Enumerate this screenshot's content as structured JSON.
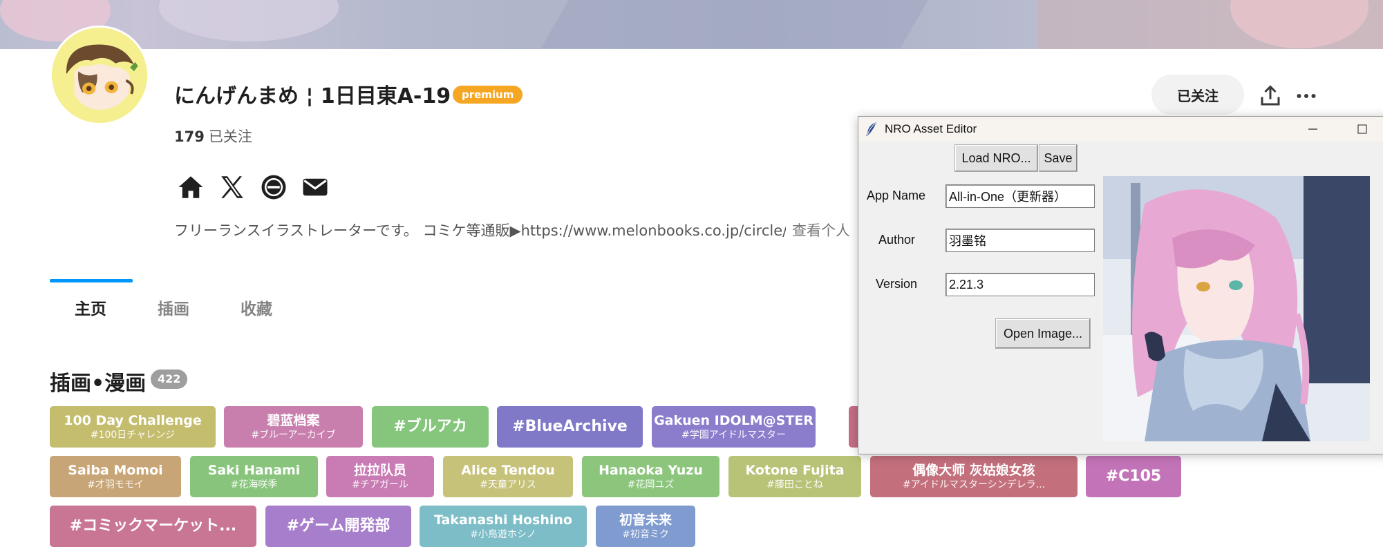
{
  "profile": {
    "name": "にんげんまめ ¦ 1日目東A-19",
    "premium": "premium",
    "follow_count": "179",
    "follow_label": "已关注",
    "bio": "フリーランスイラストレーターです。 コミケ等通販▶https://www.melonbooks.co.jp/circle/i",
    "bio_more": "查看个人",
    "follow_button": "已关注"
  },
  "tabs": [
    "主页",
    "插画",
    "收藏"
  ],
  "section": {
    "title": "插画•漫画",
    "count": "422"
  },
  "tags": [
    {
      "name": "100 Day Challenge",
      "sub": "#100日チャレンジ",
      "color": "#c4bd6e"
    },
    {
      "name": "碧蓝档案",
      "sub": "#ブルーアーカイブ",
      "color": "#c97fae"
    },
    {
      "name": "#ブルアカ",
      "sub": "",
      "color": "#85c57c"
    },
    {
      "name": "#BlueArchive",
      "sub": "",
      "color": "#7f79c8"
    },
    {
      "name": "Gakuen IDOLM@STER",
      "sub": "#学園アイドルマスター",
      "color": "#8b7dcc"
    },
    {
      "name": "",
      "sub": "",
      "color": "#c56f86"
    },
    {
      "name": "Saiba Momoi",
      "sub": "#才羽モモイ",
      "color": "#c8a577"
    },
    {
      "name": "Saki Hanami",
      "sub": "#花海咲季",
      "color": "#88c47c"
    },
    {
      "name": "拉拉队员",
      "sub": "#チアガール",
      "color": "#c97bb4"
    },
    {
      "name": "Alice Tendou",
      "sub": "#天童アリス",
      "color": "#c6c27a"
    },
    {
      "name": "Hanaoka Yuzu",
      "sub": "#花岡ユズ",
      "color": "#8cc57c"
    },
    {
      "name": "Kotone Fujita",
      "sub": "#藤田ことね",
      "color": "#b9c377"
    },
    {
      "name": "偶像大师 灰姑娘女孩",
      "sub": "#アイドルマスターシンデレラ...",
      "color": "#c36f7c"
    },
    {
      "name": "#C105",
      "sub": "",
      "color": "#c374b8"
    },
    {
      "name": "#コミックマーケット...",
      "sub": "",
      "color": "#c97695"
    },
    {
      "name": "#ゲーム開発部",
      "sub": "",
      "color": "#a77ecb"
    },
    {
      "name": "Takanashi Hoshino",
      "sub": "#小鳥遊ホシノ",
      "color": "#7dbdc8"
    },
    {
      "name": "初音未来",
      "sub": "#初音ミク",
      "color": "#7f9bcf"
    }
  ],
  "editor": {
    "title": "NRO Asset Editor",
    "load_button": "Load NRO...",
    "save_button": "Save",
    "app_name_label": "App Name",
    "app_name_value": "All-in-One（更新器）",
    "author_label": "Author",
    "author_value": "羽墨铭",
    "version_label": "Version",
    "version_value": "2.21.3",
    "open_image_button": "Open Image..."
  }
}
